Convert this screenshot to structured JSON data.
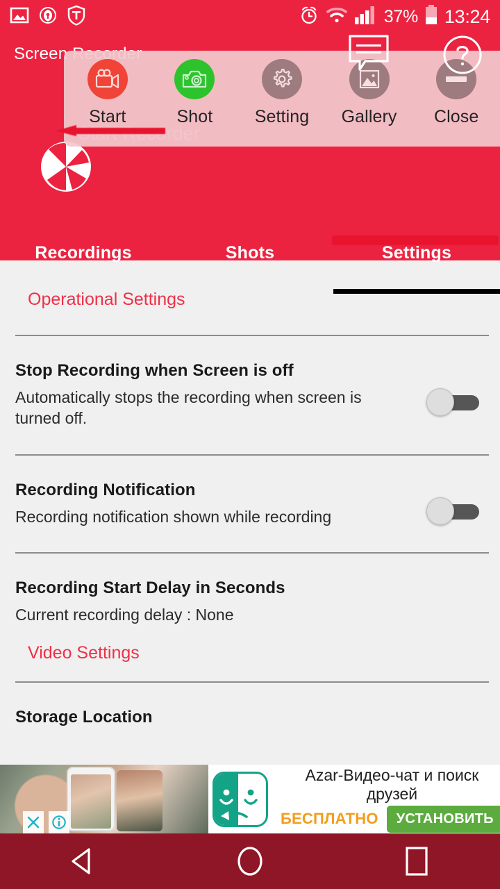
{
  "status_bar": {
    "left_icons": [
      "image-icon",
      "key-shield-icon",
      "trust-shield-icon"
    ],
    "right_icons": [
      "alarm-icon",
      "wifi-icon",
      "signal-icon",
      "battery-icon"
    ],
    "battery_percent": "37%",
    "clock": "13:24"
  },
  "app": {
    "title": "Screen Recorder",
    "watermark": "Start Recorder",
    "logo_icon": "shutter-logo-icon",
    "header_color": "#ec2340"
  },
  "floating_toolbar": {
    "background_color": "#f2c8ce",
    "accessory_icons": [
      "speech-bubble-icon",
      "help-question-icon"
    ],
    "items": [
      {
        "label": "Start",
        "icon": "video-camera-icon",
        "circle_color": "#f04438"
      },
      {
        "label": "Shot",
        "icon": "photo-camera-icon",
        "circle_color": "#2dc32d"
      },
      {
        "label": "Setting",
        "icon": "gear-icon",
        "circle_color": "#9e7b7e"
      },
      {
        "label": "Gallery",
        "icon": "image-picture-icon",
        "circle_color": "#9e7b7e"
      },
      {
        "label": "Close",
        "icon": "minus-circle-icon",
        "circle_color": "#9e7b7e"
      }
    ]
  },
  "tabs": [
    {
      "label": "Recordings",
      "active": false
    },
    {
      "label": "Shots",
      "active": false
    },
    {
      "label": "Settings",
      "active": true
    }
  ],
  "settings": {
    "section_header": "Operational Settings",
    "rows": [
      {
        "title": "Stop Recording when Screen is off",
        "subtitle": "Automatically stops the recording when screen is turned off.",
        "toggle": "off"
      },
      {
        "title": "Recording Notification",
        "subtitle": "Recording notification shown while recording",
        "toggle": "off"
      },
      {
        "title": "Recording Start Delay in Seconds",
        "subtitle": "Current recording delay : None",
        "toggle": "none"
      }
    ],
    "video_settings_link": "Video Settings",
    "storage_location_title": "Storage Location",
    "link_color": "#ee3048"
  },
  "ad": {
    "title": "Azar-Видео-чат и поиск друзей",
    "free_label": "БЕСПЛАТНО",
    "install_label": "УСТАНОВИТЬ",
    "close_icon": "close-x-icon",
    "info_icon": "info-icon",
    "app_icon": "azar-smiley-icon",
    "install_color": "#5cab3f",
    "free_color": "#f29d1d"
  },
  "navbar": {
    "background_color": "#8f1626",
    "buttons": [
      {
        "name": "back-button",
        "icon": "triangle-back-icon"
      },
      {
        "name": "home-button",
        "icon": "circle-home-icon"
      },
      {
        "name": "recents-button",
        "icon": "square-recents-icon"
      }
    ]
  }
}
